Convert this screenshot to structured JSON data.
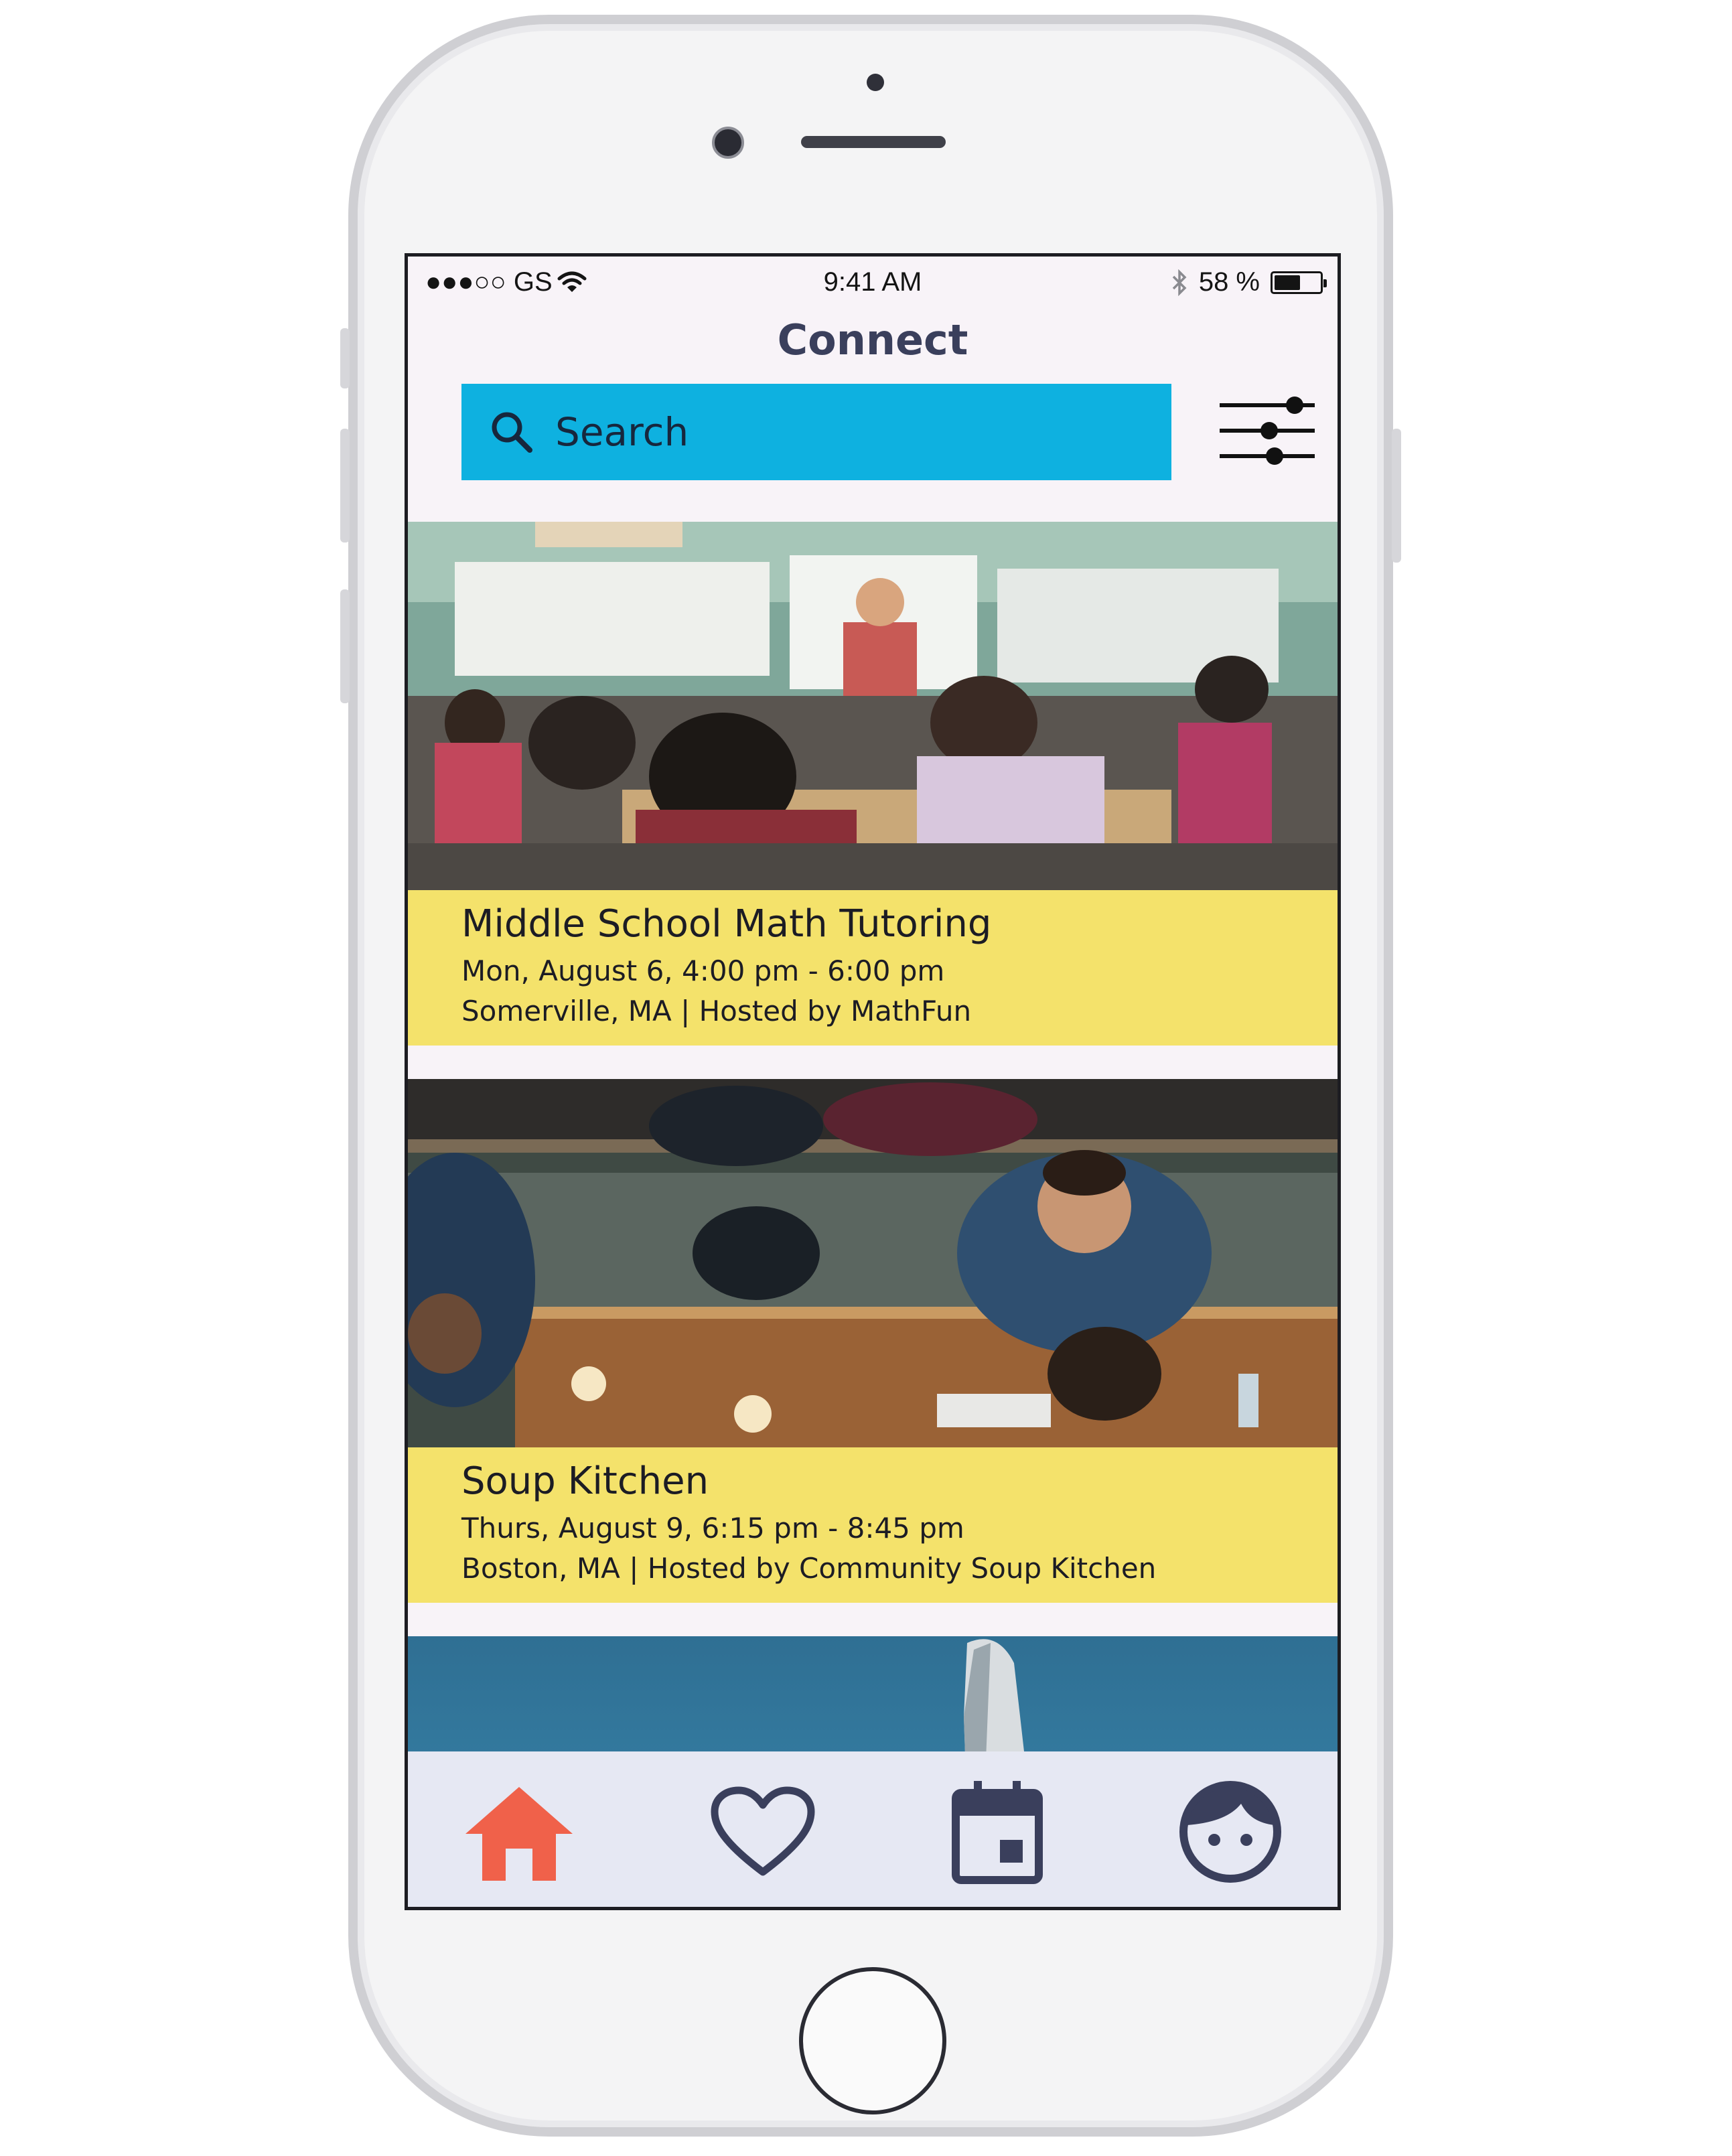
{
  "status_bar": {
    "carrier": "●●●○○ GS",
    "time": "9:41 AM",
    "battery_text": "58 %",
    "battery_level": 0.58
  },
  "header": {
    "title": "Connect"
  },
  "search": {
    "placeholder": "Search"
  },
  "events": [
    {
      "title": "Middle School Math Tutoring",
      "datetime": "Mon, August 6, 4:00 pm - 6:00 pm",
      "location_host": "Somerville, MA | Hosted by MathFun"
    },
    {
      "title": "Soup Kitchen",
      "datetime": "Thurs, August 9, 6:15 pm - 8:45 pm",
      "location_host": "Boston, MA | Hosted by Community Soup Kitchen"
    }
  ],
  "nav": {
    "items": [
      {
        "icon": "home-icon",
        "active": true
      },
      {
        "icon": "heart-icon",
        "active": false
      },
      {
        "icon": "calendar-icon",
        "active": false
      },
      {
        "icon": "profile-face-icon",
        "active": false
      }
    ]
  },
  "colors": {
    "search_bar": "#0eb1e0",
    "card_caption": "#f4e26b",
    "nav_active": "#f0614a",
    "nav_inactive": "#3a3f5c",
    "title_text": "#3a3f5c"
  }
}
